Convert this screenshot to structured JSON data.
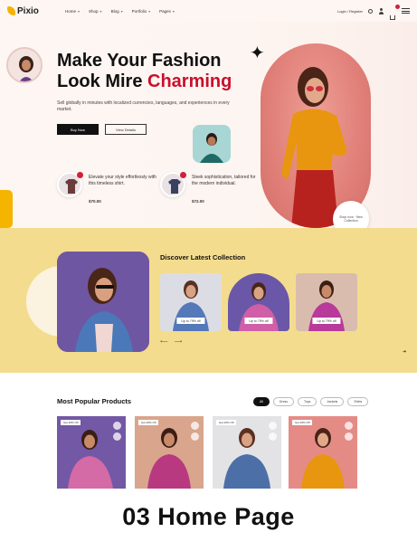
{
  "header": {
    "logo": "Pixio",
    "nav": [
      "Home",
      "Shop",
      "Blog",
      "Portfolio",
      "Pages"
    ],
    "login": "Login / Register"
  },
  "hero": {
    "title_line1": "Make Your Fashion",
    "title_line2_prefix": "Look Mire ",
    "title_line2_accent": "Charming",
    "description": "Sell globally in minutes with localized currencies, languages, and experiences in every market.",
    "buttons": [
      "Buy Now",
      "View Details"
    ],
    "products": [
      {
        "text": "Elevate your style effortlessly with this timeless shirt.",
        "price": "$70.00"
      },
      {
        "text": "Sleek sophistication, tailored for the modern individual.",
        "price": "$72.00"
      }
    ],
    "badge_text": "Shop now · New Collection",
    "colors": {
      "accent": "#c8102e",
      "yellow": "#f5b400"
    }
  },
  "collection": {
    "title": "Discover Latest Collection",
    "cards": [
      "Up to 79% off",
      "Up to 79% off",
      "Up to 79% off"
    ]
  },
  "popular": {
    "title": "Most Popular Products",
    "filters": [
      "All",
      "Dress",
      "Tops",
      "Jackets",
      "Shirts"
    ],
    "products": [
      {
        "tag": "Get 20% Off"
      },
      {
        "tag": "Get 20% Off"
      },
      {
        "tag": "Get 20% Off"
      },
      {
        "tag": "Get 20% Off"
      }
    ]
  },
  "caption": "03 Home Page"
}
